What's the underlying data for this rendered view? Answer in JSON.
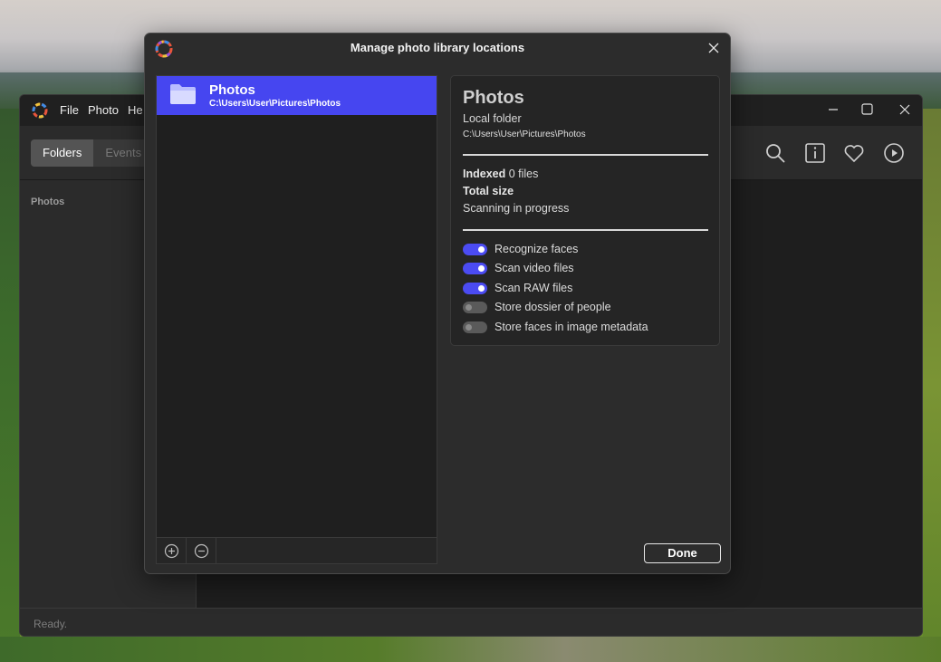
{
  "app": {
    "menu": [
      "File",
      "Photo",
      "He"
    ],
    "tabs": [
      {
        "label": "Folders",
        "active": true
      },
      {
        "label": "Events",
        "active": false
      }
    ],
    "sidebar_title": "Photos",
    "toolbar_icons": [
      "search-icon",
      "info-icon",
      "heart-icon",
      "play-icon"
    ],
    "status": "Ready."
  },
  "dialog": {
    "title": "Manage photo library locations",
    "locations": [
      {
        "name": "Photos",
        "path": "C:\\Users\\User\\Pictures\\Photos",
        "selected": true
      }
    ],
    "detail": {
      "name": "Photos",
      "type": "Local folder",
      "path": "C:\\Users\\User\\Pictures\\Photos",
      "indexed_label": "Indexed",
      "indexed_value": "0 files",
      "total_size_label": "Total size",
      "total_size_value": "",
      "status": "Scanning in progress"
    },
    "options": [
      {
        "label": "Recognize faces",
        "on": true
      },
      {
        "label": "Scan video files",
        "on": true
      },
      {
        "label": "Scan RAW files",
        "on": true
      },
      {
        "label": "Store dossier of people",
        "on": false
      },
      {
        "label": "Store faces in image metadata",
        "on": false
      }
    ],
    "done_label": "Done"
  },
  "colors": {
    "accent": "#4646f0",
    "toggle_on": "#4b4bf2",
    "toggle_off": "#5a5a5a"
  }
}
